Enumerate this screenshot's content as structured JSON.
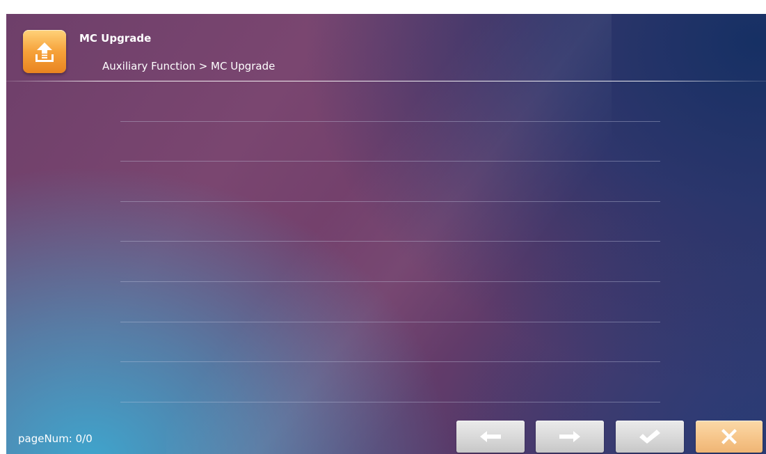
{
  "header": {
    "title": "MC Upgrade",
    "breadcrumb": "Auxiliary Function > MC Upgrade",
    "icon": "upload-icon",
    "icon_color": "#f6a23a"
  },
  "list": {
    "rows": [
      "",
      "",
      "",
      "",
      "",
      "",
      "",
      ""
    ]
  },
  "footer": {
    "page_num": "pageNum: 0/0",
    "buttons": {
      "prev": {
        "icon": "arrow-left-icon"
      },
      "next": {
        "icon": "arrow-right-icon"
      },
      "ok": {
        "icon": "check-icon"
      },
      "cancel": {
        "icon": "close-icon",
        "color": "#f6c58a"
      }
    }
  }
}
